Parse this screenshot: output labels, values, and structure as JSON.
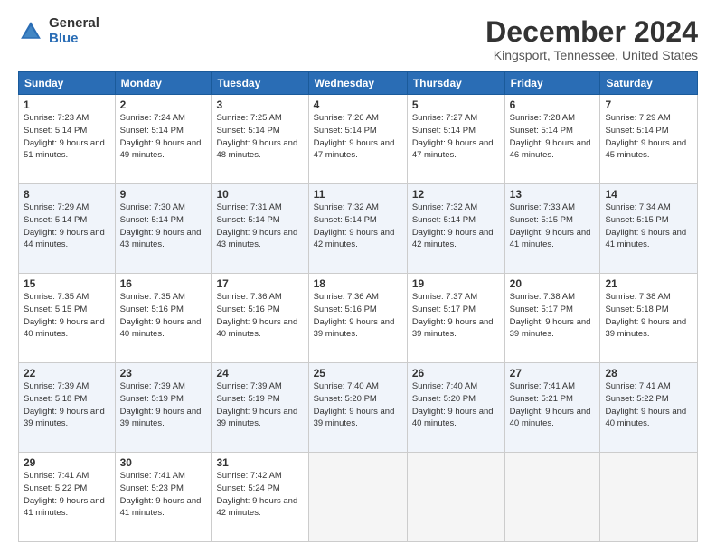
{
  "logo": {
    "general": "General",
    "blue": "Blue"
  },
  "title": "December 2024",
  "subtitle": "Kingsport, Tennessee, United States",
  "days_of_week": [
    "Sunday",
    "Monday",
    "Tuesday",
    "Wednesday",
    "Thursday",
    "Friday",
    "Saturday"
  ],
  "weeks": [
    [
      {
        "day": "1",
        "sunrise": "7:23 AM",
        "sunset": "5:14 PM",
        "daylight": "9 hours and 51 minutes."
      },
      {
        "day": "2",
        "sunrise": "7:24 AM",
        "sunset": "5:14 PM",
        "daylight": "9 hours and 49 minutes."
      },
      {
        "day": "3",
        "sunrise": "7:25 AM",
        "sunset": "5:14 PM",
        "daylight": "9 hours and 48 minutes."
      },
      {
        "day": "4",
        "sunrise": "7:26 AM",
        "sunset": "5:14 PM",
        "daylight": "9 hours and 47 minutes."
      },
      {
        "day": "5",
        "sunrise": "7:27 AM",
        "sunset": "5:14 PM",
        "daylight": "9 hours and 47 minutes."
      },
      {
        "day": "6",
        "sunrise": "7:28 AM",
        "sunset": "5:14 PM",
        "daylight": "9 hours and 46 minutes."
      },
      {
        "day": "7",
        "sunrise": "7:29 AM",
        "sunset": "5:14 PM",
        "daylight": "9 hours and 45 minutes."
      }
    ],
    [
      {
        "day": "8",
        "sunrise": "7:29 AM",
        "sunset": "5:14 PM",
        "daylight": "9 hours and 44 minutes."
      },
      {
        "day": "9",
        "sunrise": "7:30 AM",
        "sunset": "5:14 PM",
        "daylight": "9 hours and 43 minutes."
      },
      {
        "day": "10",
        "sunrise": "7:31 AM",
        "sunset": "5:14 PM",
        "daylight": "9 hours and 43 minutes."
      },
      {
        "day": "11",
        "sunrise": "7:32 AM",
        "sunset": "5:14 PM",
        "daylight": "9 hours and 42 minutes."
      },
      {
        "day": "12",
        "sunrise": "7:32 AM",
        "sunset": "5:14 PM",
        "daylight": "9 hours and 42 minutes."
      },
      {
        "day": "13",
        "sunrise": "7:33 AM",
        "sunset": "5:15 PM",
        "daylight": "9 hours and 41 minutes."
      },
      {
        "day": "14",
        "sunrise": "7:34 AM",
        "sunset": "5:15 PM",
        "daylight": "9 hours and 41 minutes."
      }
    ],
    [
      {
        "day": "15",
        "sunrise": "7:35 AM",
        "sunset": "5:15 PM",
        "daylight": "9 hours and 40 minutes."
      },
      {
        "day": "16",
        "sunrise": "7:35 AM",
        "sunset": "5:16 PM",
        "daylight": "9 hours and 40 minutes."
      },
      {
        "day": "17",
        "sunrise": "7:36 AM",
        "sunset": "5:16 PM",
        "daylight": "9 hours and 40 minutes."
      },
      {
        "day": "18",
        "sunrise": "7:36 AM",
        "sunset": "5:16 PM",
        "daylight": "9 hours and 39 minutes."
      },
      {
        "day": "19",
        "sunrise": "7:37 AM",
        "sunset": "5:17 PM",
        "daylight": "9 hours and 39 minutes."
      },
      {
        "day": "20",
        "sunrise": "7:38 AM",
        "sunset": "5:17 PM",
        "daylight": "9 hours and 39 minutes."
      },
      {
        "day": "21",
        "sunrise": "7:38 AM",
        "sunset": "5:18 PM",
        "daylight": "9 hours and 39 minutes."
      }
    ],
    [
      {
        "day": "22",
        "sunrise": "7:39 AM",
        "sunset": "5:18 PM",
        "daylight": "9 hours and 39 minutes."
      },
      {
        "day": "23",
        "sunrise": "7:39 AM",
        "sunset": "5:19 PM",
        "daylight": "9 hours and 39 minutes."
      },
      {
        "day": "24",
        "sunrise": "7:39 AM",
        "sunset": "5:19 PM",
        "daylight": "9 hours and 39 minutes."
      },
      {
        "day": "25",
        "sunrise": "7:40 AM",
        "sunset": "5:20 PM",
        "daylight": "9 hours and 39 minutes."
      },
      {
        "day": "26",
        "sunrise": "7:40 AM",
        "sunset": "5:20 PM",
        "daylight": "9 hours and 40 minutes."
      },
      {
        "day": "27",
        "sunrise": "7:41 AM",
        "sunset": "5:21 PM",
        "daylight": "9 hours and 40 minutes."
      },
      {
        "day": "28",
        "sunrise": "7:41 AM",
        "sunset": "5:22 PM",
        "daylight": "9 hours and 40 minutes."
      }
    ],
    [
      {
        "day": "29",
        "sunrise": "7:41 AM",
        "sunset": "5:22 PM",
        "daylight": "9 hours and 41 minutes."
      },
      {
        "day": "30",
        "sunrise": "7:41 AM",
        "sunset": "5:23 PM",
        "daylight": "9 hours and 41 minutes."
      },
      {
        "day": "31",
        "sunrise": "7:42 AM",
        "sunset": "5:24 PM",
        "daylight": "9 hours and 42 minutes."
      },
      null,
      null,
      null,
      null
    ]
  ],
  "labels": {
    "sunrise": "Sunrise:",
    "sunset": "Sunset:",
    "daylight": "Daylight:"
  }
}
